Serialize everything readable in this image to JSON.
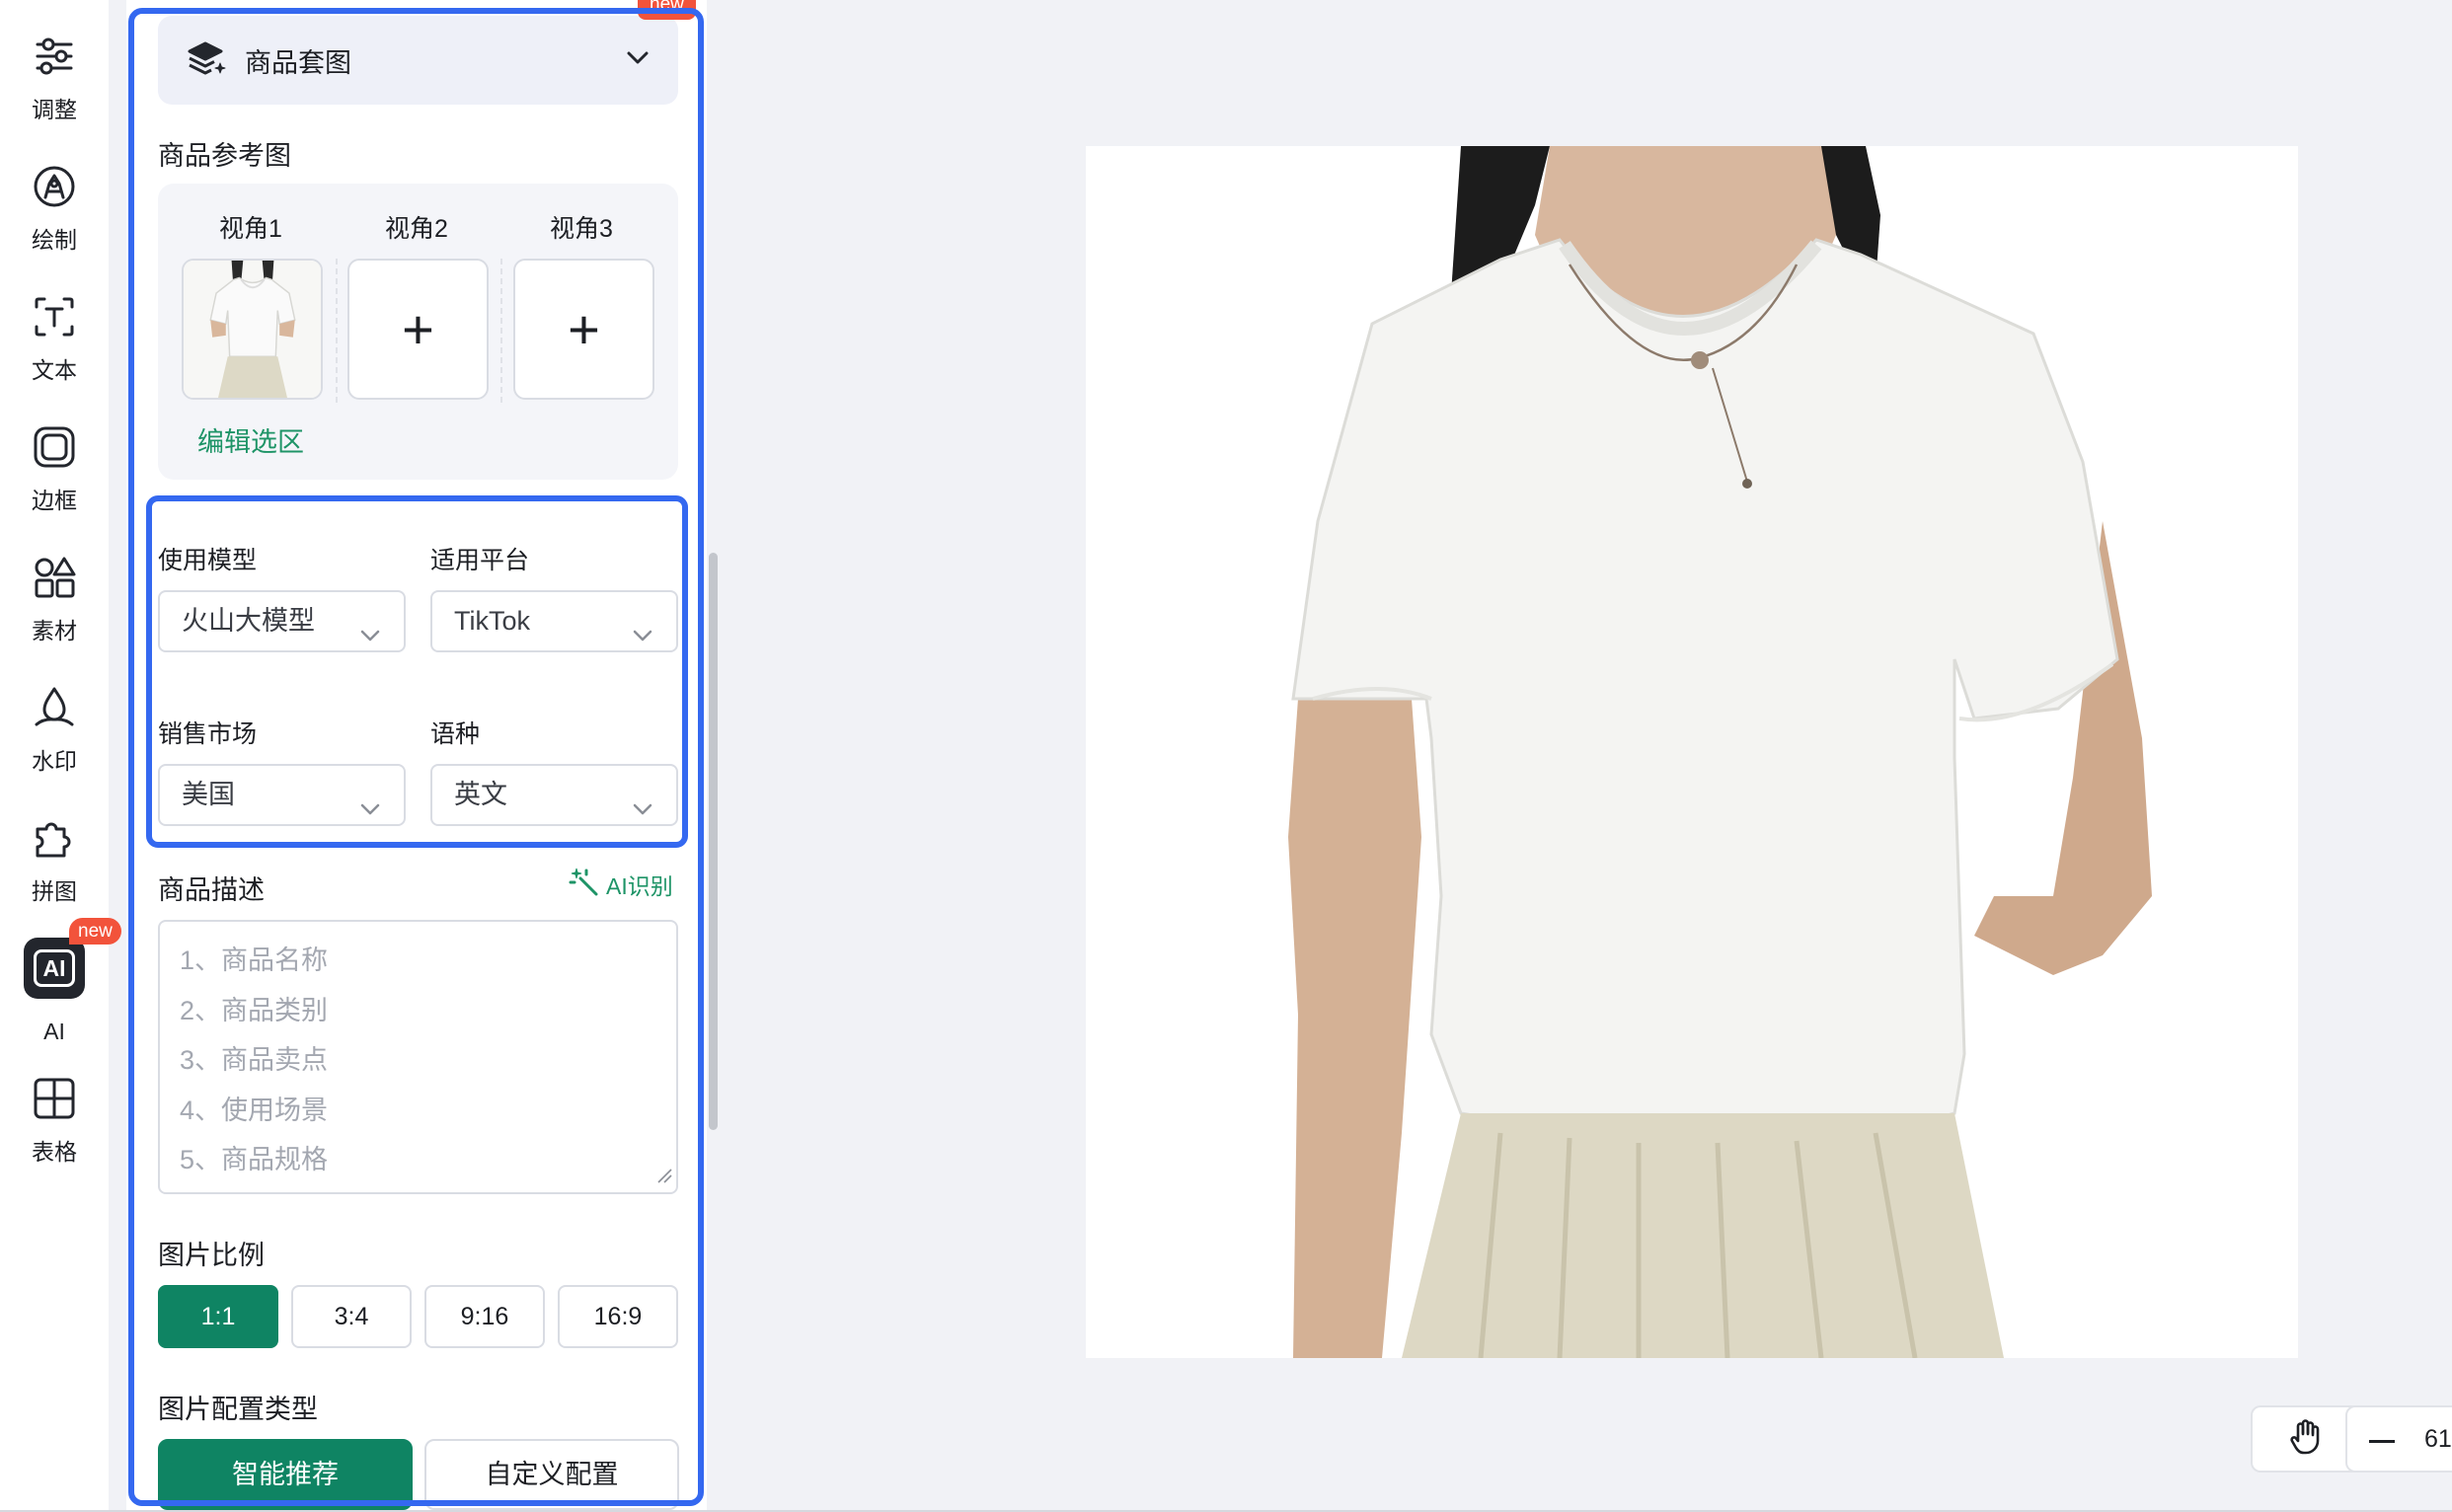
{
  "sidebar": {
    "items": [
      {
        "label": "调整",
        "icon": "sliders-icon"
      },
      {
        "label": "绘制",
        "icon": "draw-icon"
      },
      {
        "label": "文本",
        "icon": "text-icon"
      },
      {
        "label": "边框",
        "icon": "frame-icon"
      },
      {
        "label": "素材",
        "icon": "shapes-icon"
      },
      {
        "label": "水印",
        "icon": "watermark-icon"
      },
      {
        "label": "拼图",
        "icon": "puzzle-icon"
      },
      {
        "label": "AI",
        "icon": "ai-icon",
        "badge": "new",
        "active": true
      },
      {
        "label": "表格",
        "icon": "table-icon"
      }
    ]
  },
  "panel": {
    "top_badge": "new",
    "mode": {
      "label": "商品套图",
      "icon": "layers-sparkle-icon"
    },
    "reference": {
      "title": "商品参考图",
      "views": [
        {
          "label": "视角1",
          "state": "filled"
        },
        {
          "label": "视角2",
          "state": "empty",
          "add": "+"
        },
        {
          "label": "视角3",
          "state": "empty",
          "add": "+"
        }
      ],
      "edit_link": "编辑选区"
    },
    "model": {
      "label": "使用模型",
      "value": "火山大模型"
    },
    "platform": {
      "label": "适用平台",
      "value": "TikTok"
    },
    "market": {
      "label": "销售市场",
      "value": "美国"
    },
    "language": {
      "label": "语种",
      "value": "英文"
    },
    "description": {
      "title": "商品描述",
      "ai_button": "AI识别",
      "placeholder_lines": [
        "1、商品名称",
        "2、商品类别",
        "3、商品卖点",
        "4、使用场景",
        "5、商品规格"
      ]
    },
    "ratio": {
      "title": "图片比例",
      "options": [
        "1:1",
        "3:4",
        "9:16",
        "16:9"
      ],
      "selected": "1:1"
    },
    "config_type": {
      "title": "图片配置类型",
      "options": [
        "智能推荐",
        "自定义配置"
      ],
      "selected": "智能推荐"
    }
  },
  "canvas": {
    "image_subject": "white-tshirt-product-photo",
    "zoom_text": "61"
  },
  "colors": {
    "accent_green": "#0f8463",
    "link_green": "#1e9467",
    "highlight_blue": "#3468f0",
    "badge_red": "#f2533b"
  }
}
